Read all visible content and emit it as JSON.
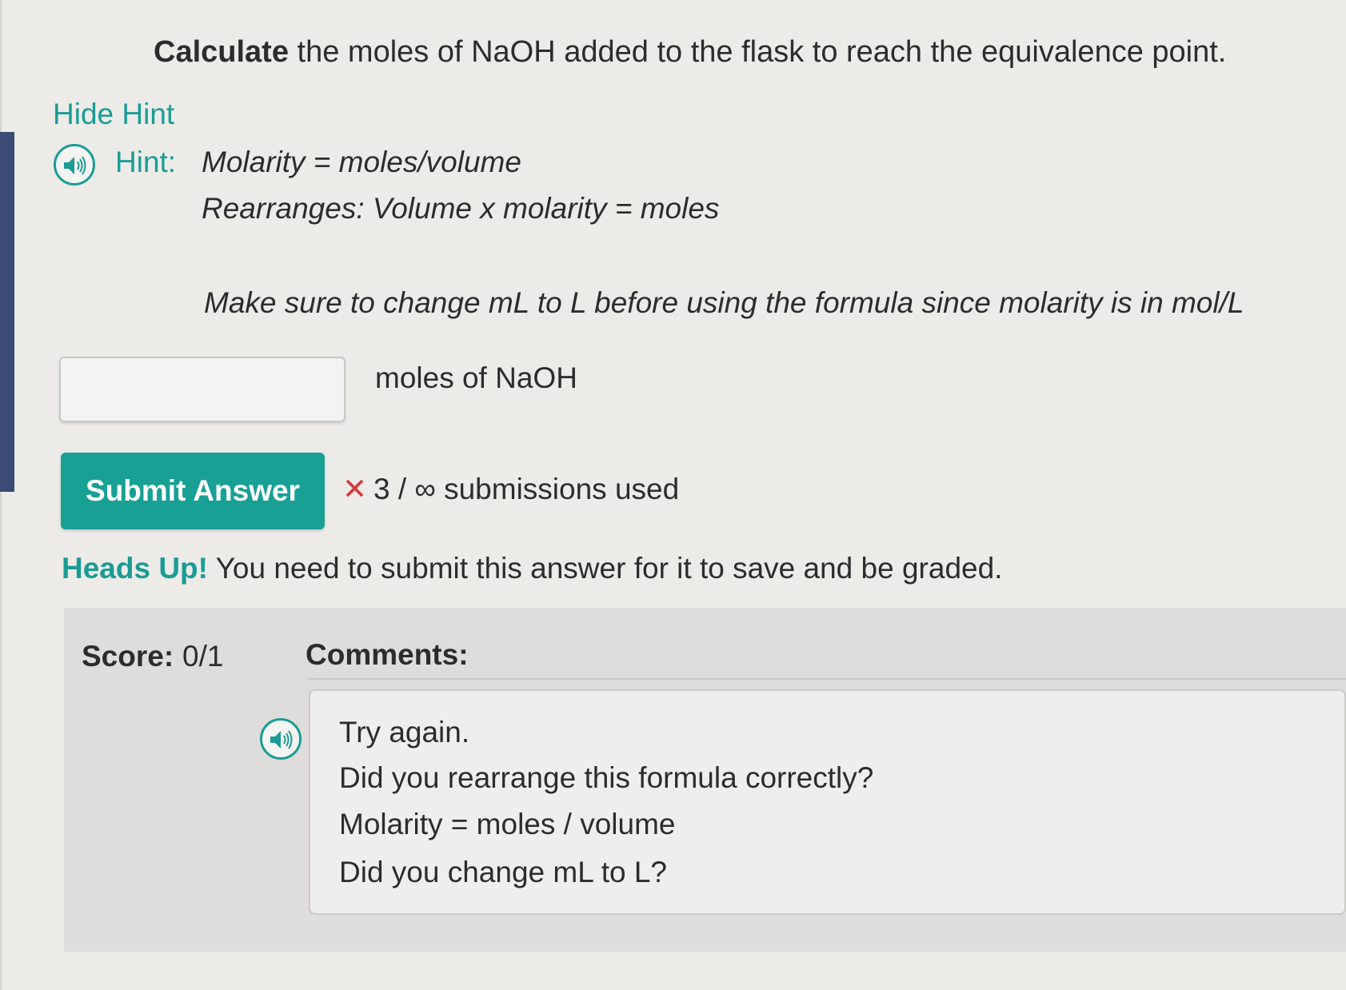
{
  "question": {
    "lead": "Calculate",
    "rest": " the moles of NaOH added to the flask to reach the equivalence point."
  },
  "hint_toggle": "Hide Hint",
  "hint": {
    "label": "Hint:",
    "line1": "Molarity = moles/volume",
    "line2": "Rearranges: Volume x molarity = moles",
    "line3": "Make sure to change mL to L before using the formula since molarity is in mol/L",
    "audio_icon": "speaker-icon"
  },
  "answer": {
    "value": "",
    "unit": "moles of NaOH"
  },
  "submit": {
    "label": "Submit Answer",
    "x_mark": "✕",
    "used_text": "3 / ∞ submissions used"
  },
  "heads_up": {
    "strong": "Heads Up!",
    "text": " You need to submit this answer for it to save and be graded."
  },
  "score": {
    "label": "Score:",
    "value": "0/1"
  },
  "comments": {
    "label": "Comments:",
    "lines": [
      "Try again.",
      "Did you rearrange this formula correctly?",
      "Molarity = moles / volume",
      "Did you change mL to L?"
    ],
    "audio_icon": "speaker-icon"
  },
  "colors": {
    "accent": "#1a9c94",
    "button": "#18a095",
    "error": "#d43a3a",
    "background": "#ecebe8",
    "panel": "#dedddb"
  }
}
